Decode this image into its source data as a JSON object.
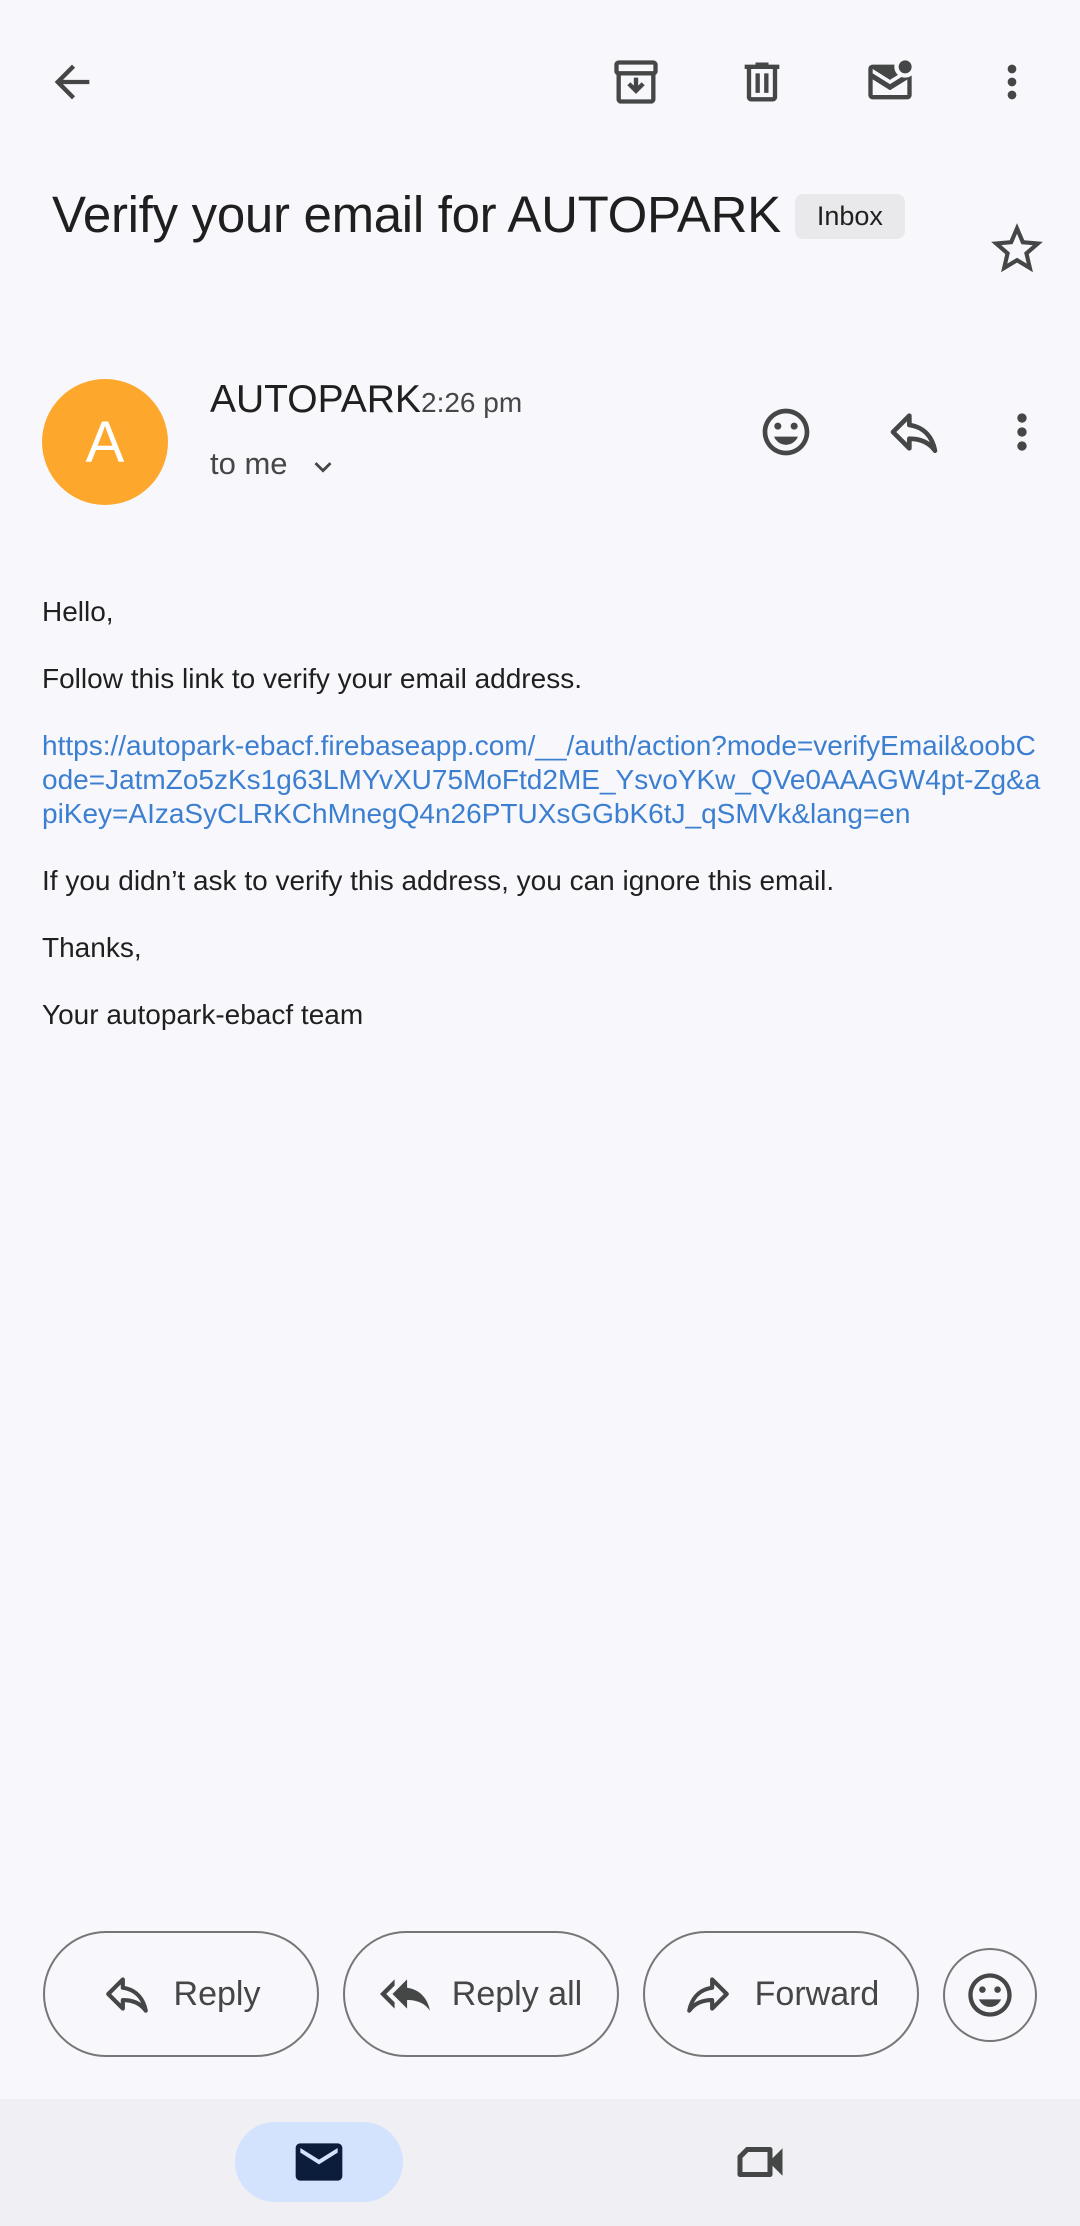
{
  "toolbar": {
    "back_icon": "arrow-back-icon",
    "archive_icon": "archive-icon",
    "delete_icon": "trash-icon",
    "unread_icon": "mark-unread-icon",
    "more_icon": "more-vert-icon"
  },
  "email": {
    "subject": "Verify your email for AUTOPARK",
    "label": "Inbox",
    "starred": false,
    "sender": {
      "initial": "A",
      "name": "AUTOPARK",
      "time": "2:26 pm",
      "recipients": "to me",
      "avatar_color": "#fda82d"
    },
    "body": {
      "greeting": "Hello,",
      "instruction": "Follow this link to verify your email address.",
      "link": "https://autopark-ebacf.firebaseapp.com/__/auth/action?mode=verifyEmail&oobCode=JatmZo5zKs1g63LMYvXU75MoFtd2ME_YsvoYKw_QVe0AAAGW4pt-Zg&apiKey=AIzaSyCLRKChMnegQ4n26PTUXsGGbK6tJ_qSMVk&lang=en",
      "ignore_note": "If you didn’t ask to verify this address, you can ignore this email.",
      "thanks": "Thanks,",
      "signature": "Your autopark-ebacf team"
    }
  },
  "actions": {
    "reply": "Reply",
    "reply_all": "Reply all",
    "forward": "Forward"
  },
  "bottom_nav": {
    "items": [
      {
        "icon": "mail-icon",
        "active": true
      },
      {
        "icon": "video-camera-icon",
        "active": false
      }
    ]
  },
  "colors": {
    "background": "#f8f8fc",
    "link": "#3c7fd1",
    "nav_active": "#d3e3fd",
    "avatar": "#fda82d"
  }
}
